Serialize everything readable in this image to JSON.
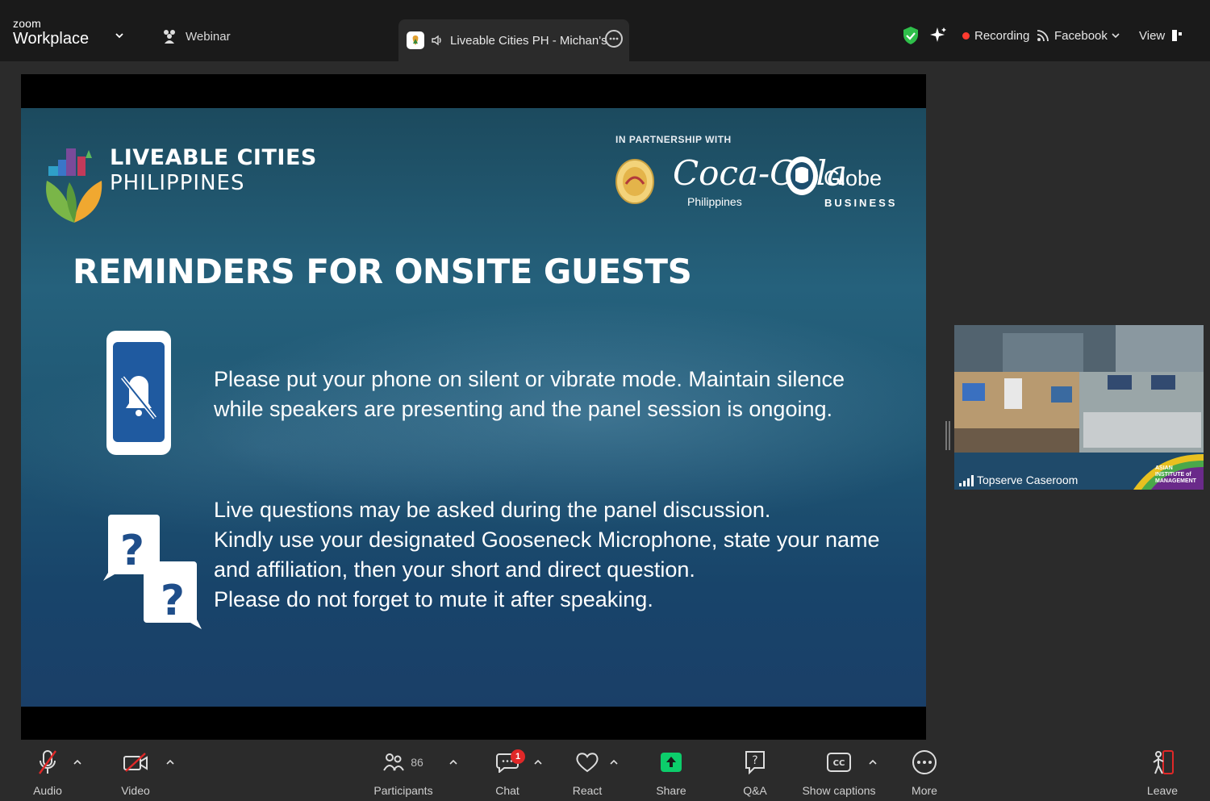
{
  "app": {
    "brand_small": "zoom",
    "brand_large": "Workplace"
  },
  "webinar": {
    "label": "Webinar"
  },
  "tab": {
    "title": "Liveable Cities PH - Michan's"
  },
  "status": {
    "recording": "Recording",
    "facebook": "Facebook",
    "view": "View"
  },
  "slide": {
    "logo_line1": "LIVEABLE CITIES",
    "logo_line2": "PHILIPPINES",
    "partner_heading": "IN PARTNERSHIP WITH",
    "partner_cc": "Coca-Cola",
    "partner_cc_sub": "Philippines",
    "partner_globe": "Globe",
    "partner_globe_sub": "BUSINESS",
    "title": "REMINDERS FOR ONSITE GUESTS",
    "reminder1": "Please put your phone on silent or vibrate mode. Maintain silence while speakers are presenting and the panel session is ongoing.",
    "reminder2_line1": "Live questions may be asked during the panel discussion.",
    "reminder2_line2": "Kindly use your designated Gooseneck Microphone, state your name",
    "reminder2_line3": "and affiliation, then your short and direct question.",
    "reminder2_line4": "Please do not forget to mute it after speaking."
  },
  "video_tile": {
    "name": "Topserve Caseroom",
    "sign": "ASIAN INSTITUTE of MANAGEMENT"
  },
  "toolbar": {
    "audio": "Audio",
    "video": "Video",
    "participants": "Participants",
    "participants_count": "86",
    "chat": "Chat",
    "chat_badge": "1",
    "react": "React",
    "share": "Share",
    "qa": "Q&A",
    "captions": "Show captions",
    "more": "More",
    "leave": "Leave"
  },
  "colors": {
    "accent_green": "#22c55e",
    "record_red": "#ff3b30",
    "share_green": "#0ccd6b",
    "leave_red": "#e02828",
    "shield_green": "#2fbf4a"
  }
}
